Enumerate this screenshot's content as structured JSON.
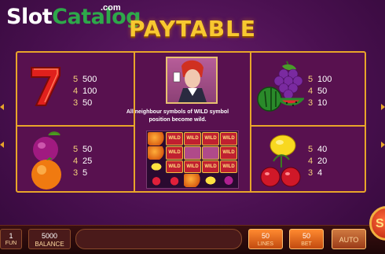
{
  "watermark": {
    "slot": "Slot",
    "catalog": "Catalog",
    "com": ".com"
  },
  "title": "PAYTABLE",
  "symbols": {
    "seven": {
      "pays": [
        [
          "5",
          "500"
        ],
        [
          "4",
          "100"
        ],
        [
          "3",
          "50"
        ]
      ]
    },
    "grapes_watermelon": {
      "pays": [
        [
          "5",
          "100"
        ],
        [
          "4",
          "50"
        ],
        [
          "3",
          "10"
        ]
      ]
    },
    "plum_orange": {
      "pays": [
        [
          "5",
          "50"
        ],
        [
          "4",
          "25"
        ],
        [
          "3",
          "5"
        ]
      ]
    },
    "lemon_cherry": {
      "pays": [
        [
          "5",
          "40"
        ],
        [
          "4",
          "20"
        ],
        [
          "3",
          "4"
        ]
      ]
    }
  },
  "wild": {
    "description": "All neighbour symbols of WILD symbol position become wild.",
    "tile_label": "WILD"
  },
  "bottom_bar": {
    "free_count": "1",
    "free_label": "FUN",
    "balance_value": "5000",
    "balance_label": "BALANCE",
    "lines_value": "50",
    "lines_label": "LINES",
    "bet_value": "50",
    "bet_label": "BET",
    "auto_label": "AUTO",
    "spin_label": "S"
  },
  "colors": {
    "gold": "#e8a52a",
    "background": "#4a1050",
    "watermark_green": "#2ea84a"
  }
}
